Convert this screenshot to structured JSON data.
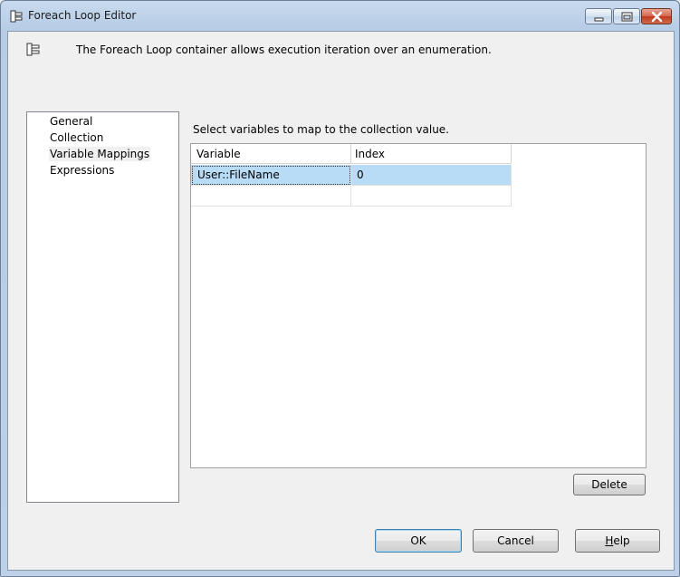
{
  "window": {
    "title": "Foreach Loop Editor",
    "controls": [
      "minimize-icon",
      "maximize-icon",
      "close-icon"
    ]
  },
  "banner": {
    "text": "The Foreach Loop container allows execution iteration over an enumeration."
  },
  "nav": {
    "items": [
      {
        "label": "General",
        "selected": false
      },
      {
        "label": "Collection",
        "selected": false
      },
      {
        "label": "Variable Mappings",
        "selected": true
      },
      {
        "label": "Expressions",
        "selected": false
      }
    ]
  },
  "main": {
    "instruction": "Select variables to map to the collection value.",
    "grid": {
      "columns": [
        "Variable",
        "Index"
      ],
      "rows": [
        [
          "User::FileName",
          "0"
        ],
        [
          "",
          ""
        ]
      ]
    },
    "delete_label": "Delete"
  },
  "footer": {
    "ok_label": "OK",
    "cancel_label": "Cancel",
    "help_label_first": "H",
    "help_label_rest": "elp"
  },
  "colors": {
    "selected_row": "#b9dcf6",
    "title_gradient": "#c8daee"
  }
}
